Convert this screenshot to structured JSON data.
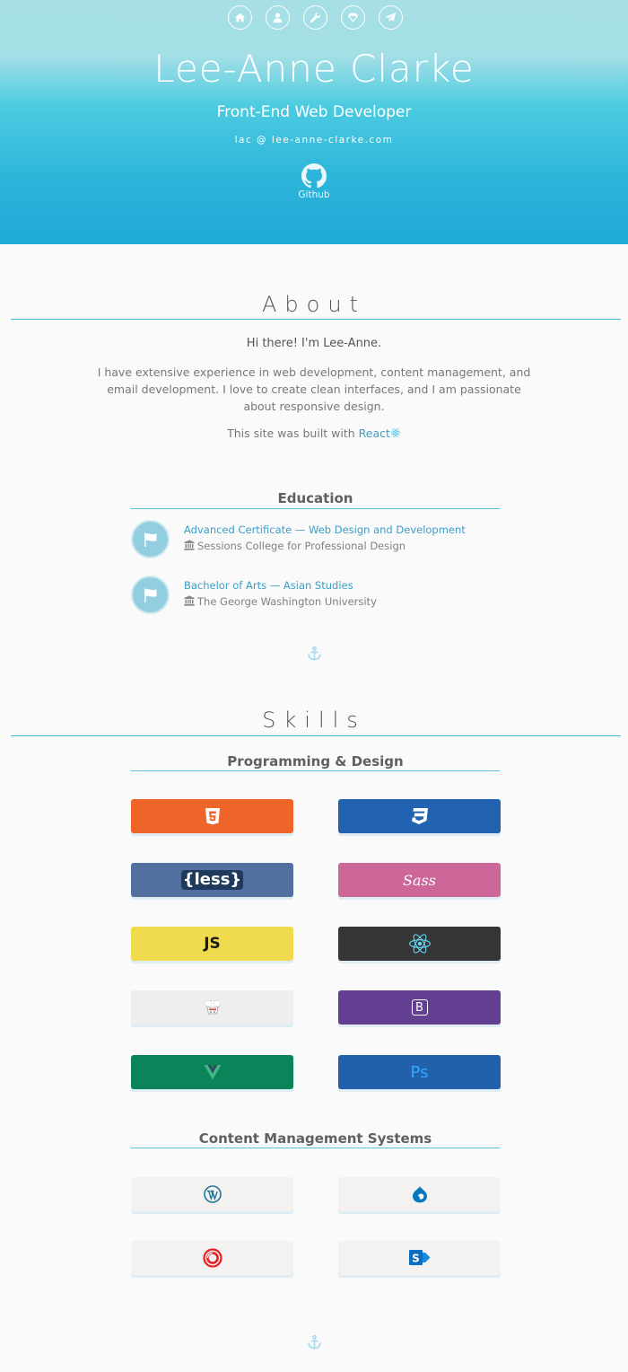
{
  "nav": {
    "items": [
      {
        "icon": "home-icon"
      },
      {
        "icon": "user-icon"
      },
      {
        "icon": "wrench-icon"
      },
      {
        "icon": "diamond-icon"
      },
      {
        "icon": "paper-plane-icon"
      }
    ]
  },
  "header": {
    "name": "Lee-Anne Clarke",
    "role": "Front-End Web Developer",
    "email": "lac @ lee-anne-clarke.com",
    "github_label": "Github"
  },
  "about": {
    "title": "About",
    "greeting": "Hi there! I'm Lee-Anne.",
    "body": "I have extensive experience in web development, content management, and email development. I love to create clean interfaces, and I am passionate about responsive design.",
    "built_prefix": "This site was built with ",
    "built_link": "React"
  },
  "education": {
    "title": "Education",
    "items": [
      {
        "degree": "Advanced Certificate — Web Design and Development",
        "school": "Sessions College for Professional Design"
      },
      {
        "degree": "Bachelor of Arts — Asian Studies",
        "school": "The George Washington University"
      }
    ]
  },
  "skills": {
    "title": "Skills",
    "programming": {
      "title": "Programming & Design",
      "tiles": [
        {
          "icon": "html5-icon",
          "color": "#ee6429"
        },
        {
          "icon": "css3-icon",
          "color": "#2163b1"
        },
        {
          "icon": "less-icon",
          "label": "{less}",
          "color": "#51709f"
        },
        {
          "icon": "sass-icon",
          "label": "Sass",
          "color": "#cd6799"
        },
        {
          "icon": "javascript-icon",
          "label": "JS",
          "color": "#f0db4f"
        },
        {
          "icon": "react-icon",
          "color": "#353535"
        },
        {
          "icon": "gulp-icon",
          "color": "#eeeeee"
        },
        {
          "icon": "bootstrap-icon",
          "label": "B",
          "color": "#623f91"
        },
        {
          "icon": "vue-icon",
          "color": "#0b8459"
        },
        {
          "icon": "photoshop-icon",
          "label": "Ps",
          "color": "#2360ac"
        }
      ]
    },
    "cms": {
      "title": "Content Management Systems",
      "tiles": [
        {
          "icon": "wordpress-icon"
        },
        {
          "icon": "drupal-icon"
        },
        {
          "icon": "sitecore-icon"
        },
        {
          "icon": "sharepoint-icon"
        }
      ]
    }
  }
}
